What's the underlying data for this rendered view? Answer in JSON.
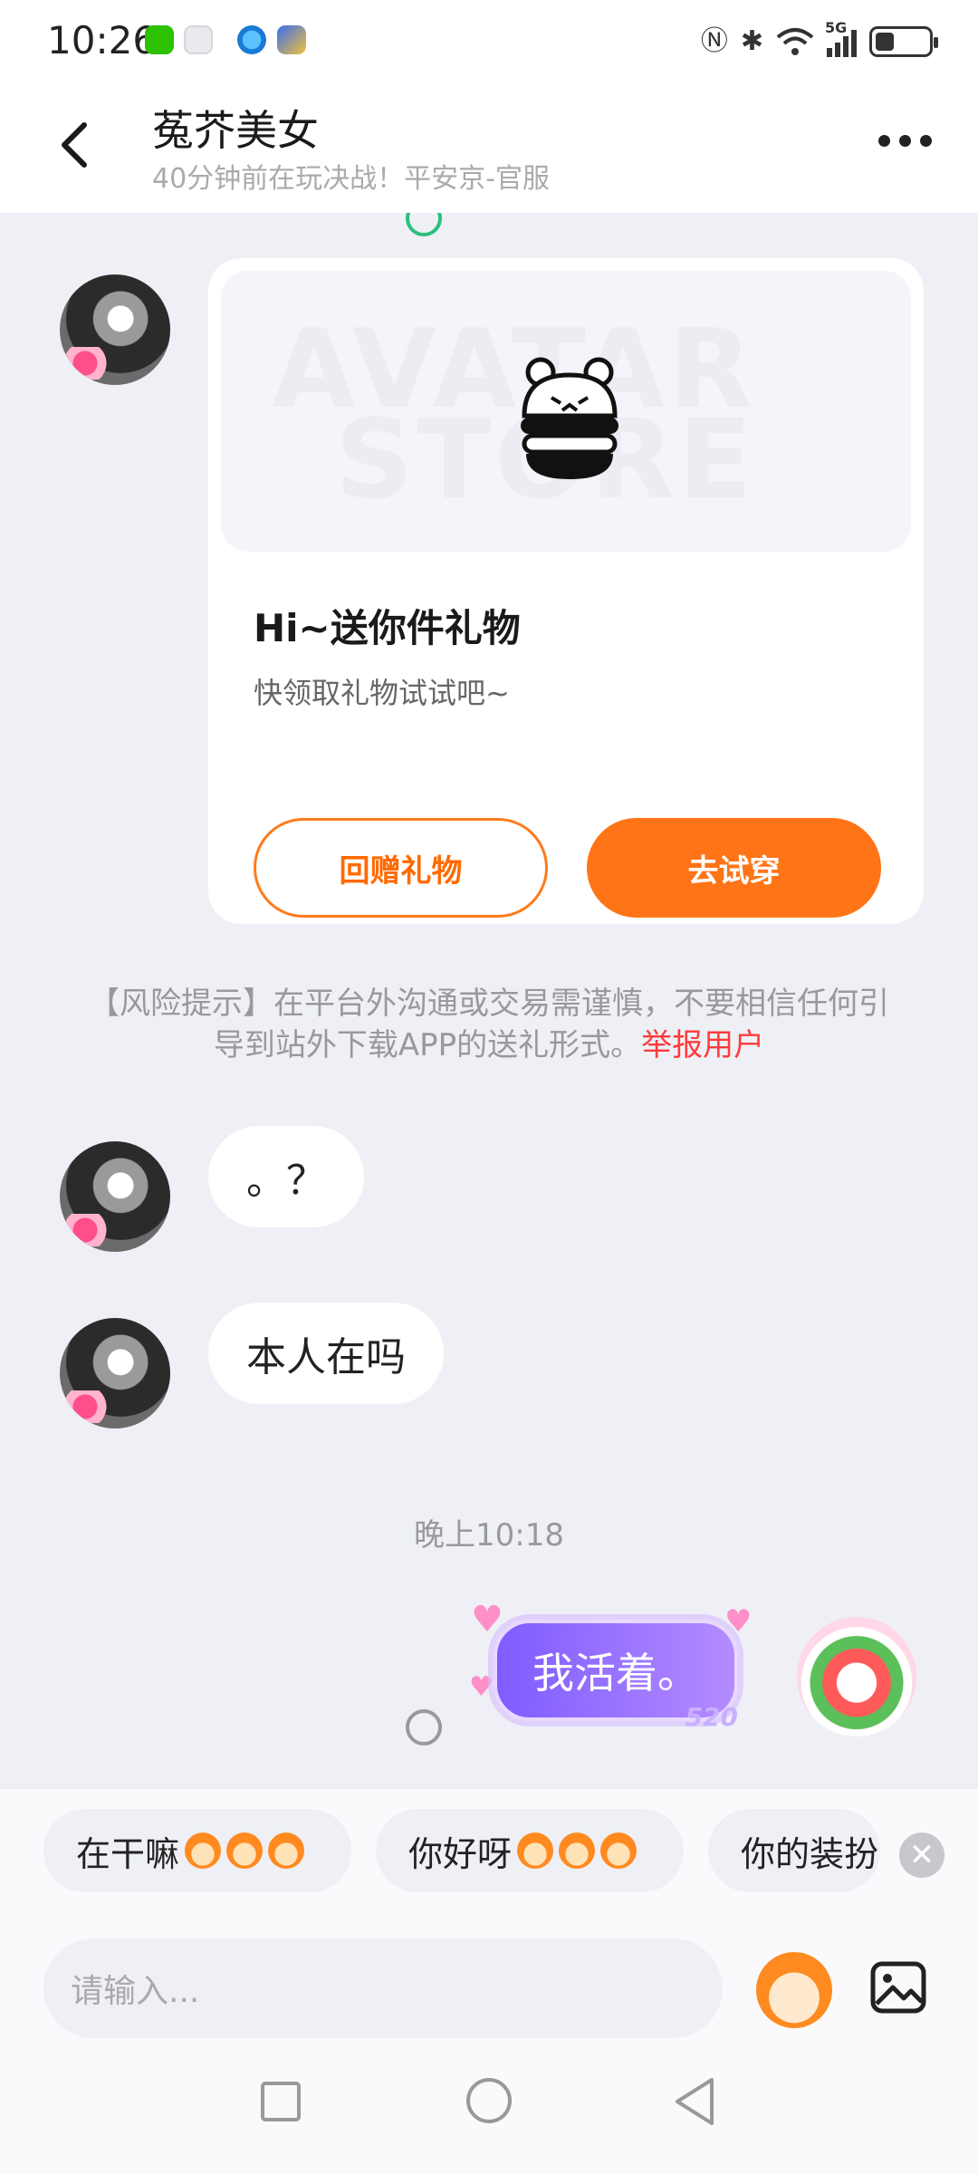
{
  "status_bar": {
    "time": "10:26",
    "signal_label": "5G",
    "battery_level": 0.3
  },
  "header": {
    "title": "菟芥美女",
    "subtitle": "40分钟前在玩决战！平安京-官服"
  },
  "gift_card": {
    "title": "Hi~送你件礼物",
    "subtitle": "快领取礼物试试吧~",
    "watermark_line1": "AVATAR",
    "watermark_line2": "STORE",
    "return_gift_label": "回赠礼物",
    "try_on_label": "去试穿",
    "accent_color": "#ff7416"
  },
  "risk_notice": {
    "text": "【风险提示】在平台外沟通或交易需谨慎，不要相信任何引导到站外下载APP的送礼形式。",
    "report_label": "举报用户",
    "report_color": "#ff3b3b"
  },
  "messages": [
    {
      "sender": "other",
      "text": "。？"
    },
    {
      "sender": "other",
      "text": "本人在吗"
    }
  ],
  "timestamp": "晚上10:18",
  "my_message": {
    "text": "我活着。",
    "bubble_tag": "520"
  },
  "quick_replies": [
    {
      "label": "在干嘛"
    },
    {
      "label": "你好呀"
    },
    {
      "label": "你的装扮"
    }
  ],
  "input": {
    "placeholder": "请输入..."
  }
}
